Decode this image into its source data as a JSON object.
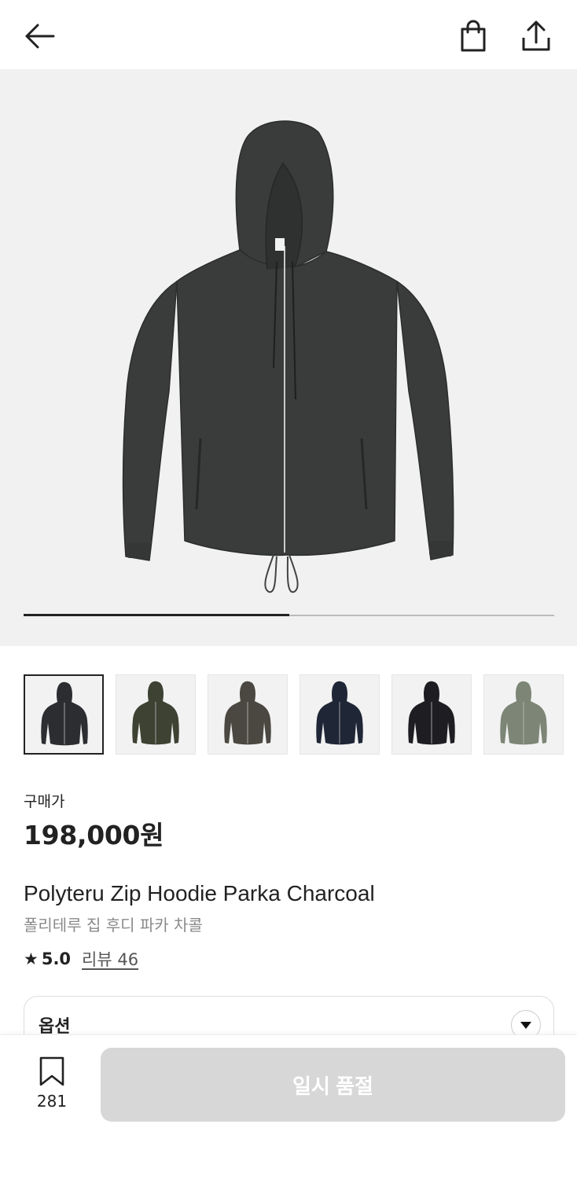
{
  "header": {
    "back_icon": "arrow-left-icon",
    "bag_icon": "shopping-bag-icon",
    "share_icon": "share-upload-icon"
  },
  "gallery": {
    "progress": 0.5,
    "thumbnails": [
      {
        "color": "#2b2d30",
        "selected": true
      },
      {
        "color": "#3d4232",
        "selected": false
      },
      {
        "color": "#4a4840",
        "selected": false
      },
      {
        "color": "#1f2636",
        "selected": false
      },
      {
        "color": "#1e1e22",
        "selected": false
      },
      {
        "color": "#7d8676",
        "selected": false
      }
    ]
  },
  "product": {
    "price_label": "구매가",
    "price": "198,000원",
    "name_en": "Polyteru Zip Hoodie Parka Charcoal",
    "name_ko": "폴리테루 집 후디 파카 차콜",
    "rating_star": "★",
    "rating": "5.0",
    "reviews_label": "리뷰 46"
  },
  "options": {
    "label": "옵션",
    "toggle_icon": "chevron-down-icon"
  },
  "bottom": {
    "bookmark_icon": "bookmark-icon",
    "bookmark_count": "281",
    "soldout_label": "일시 품절"
  },
  "colors": {
    "hero_bg": "#f1f1f1",
    "jacket": "#3a3b3b",
    "disabled_button": "#d7d7d7"
  }
}
